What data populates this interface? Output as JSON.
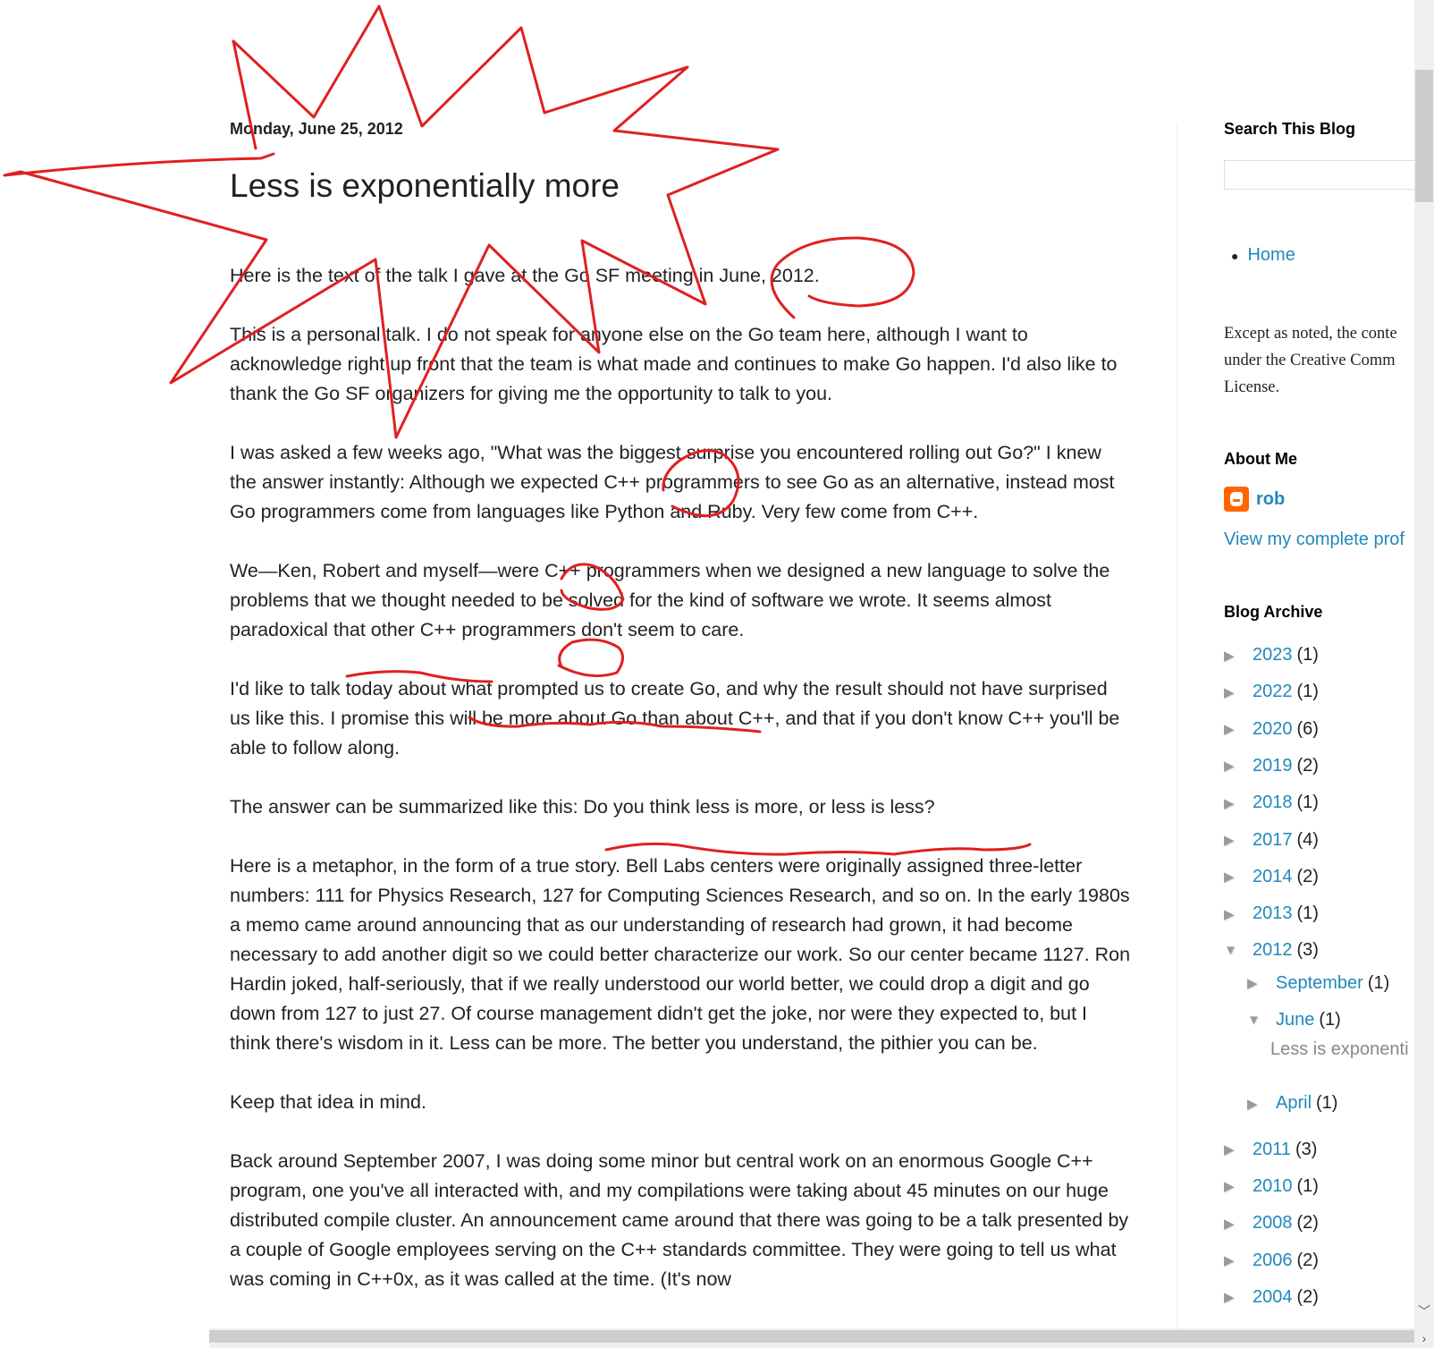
{
  "post": {
    "date": "Monday, June 25, 2012",
    "title": "Less is exponentially more",
    "paragraphs": [
      "Here is the text of the talk I gave at the Go SF meeting in June, 2012.",
      "This is a personal talk. I do not speak for anyone else on the Go team here, although I want to acknowledge right up front that the team is what made and continues to make Go happen. I'd also like to thank the Go SF organizers for giving me the opportunity to talk to you.",
      "I was asked a few weeks ago, \"What was the biggest surprise you encountered rolling out Go?\" I knew the answer instantly: Although we expected C++ programmers to see Go as an alternative, instead most Go programmers come from languages like Python and Ruby. Very few come from C++.",
      "We—Ken, Robert and myself—were C++ programmers when we designed a new language to solve the problems that we thought needed to be solved for the kind of software we wrote. It seems almost paradoxical that other C++ programmers don't seem to care.",
      "I'd like to talk today about what prompted us to create Go, and why the result should not have surprised us like this. I promise this will be more about Go than about C++, and that if you don't know C++ you'll be able to follow along.",
      "The answer can be summarized like this: Do you think less is more, or less is less?",
      "Here is a metaphor, in the form of a true story.  Bell Labs centers were originally assigned three-letter numbers: 111 for Physics Research, 127 for Computing Sciences Research, and so on. In the early 1980s a memo came around announcing that as our understanding of research had grown, it had become necessary to add another digit so we could better characterize our work. So our center became 1127. Ron Hardin joked, half-seriously, that if we really understood our world better, we could drop a digit and go down from 127 to just 27. Of course management didn't get the joke, nor were they expected to, but I think there's wisdom in it. Less can be more. The better you understand, the pithier you can be.",
      "Keep that idea in mind.",
      "Back around September 2007, I was doing some minor but central work on an enormous Google C++ program, one you've all interacted with, and my compilations were taking about 45 minutes on our huge distributed compile cluster. An announcement came around that there was going to be a talk presented by a couple of Google employees serving on the C++ standards committee. They were going to tell us what was coming in C++0x, as it was called at the time. (It's now"
    ]
  },
  "sidebar": {
    "search_title": "Search This Blog",
    "search_value": "",
    "pages": [
      {
        "label": "Home"
      }
    ],
    "license_lines": [
      "Except as noted, the conte",
      "under the Creative Comm",
      "License."
    ],
    "about_title": "About Me",
    "profile_name": "rob",
    "profile_icon": "blogger-icon",
    "view_profile": "View my complete prof",
    "archive_title": "Blog Archive",
    "archive": [
      {
        "label": "2023",
        "count": "(1)",
        "expanded": false
      },
      {
        "label": "2022",
        "count": "(1)",
        "expanded": false
      },
      {
        "label": "2020",
        "count": "(6)",
        "expanded": false
      },
      {
        "label": "2019",
        "count": "(2)",
        "expanded": false
      },
      {
        "label": "2018",
        "count": "(1)",
        "expanded": false
      },
      {
        "label": "2017",
        "count": "(4)",
        "expanded": false
      },
      {
        "label": "2014",
        "count": "(2)",
        "expanded": false
      },
      {
        "label": "2013",
        "count": "(1)",
        "expanded": false
      },
      {
        "label": "2012",
        "count": "(3)",
        "expanded": true
      },
      {
        "label": "2011",
        "count": "(3)",
        "expanded": false
      },
      {
        "label": "2010",
        "count": "(1)",
        "expanded": false
      },
      {
        "label": "2008",
        "count": "(2)",
        "expanded": false
      },
      {
        "label": "2006",
        "count": "(2)",
        "expanded": false
      },
      {
        "label": "2004",
        "count": "(2)",
        "expanded": false
      }
    ],
    "archive_2012_months": [
      {
        "label": "September",
        "count": "(1)",
        "expanded": false
      },
      {
        "label": "June",
        "count": "(1)",
        "expanded": true
      },
      {
        "label": "April",
        "count": "(1)",
        "expanded": false
      }
    ],
    "june_posts": [
      "Less is exponenti"
    ],
    "collapsed_glyph": "▶",
    "expanded_glyph": "▼"
  },
  "scrollbars": {
    "up_glyph": "︿",
    "down_glyph": "﹀",
    "right_glyph": "›"
  },
  "annotations": {
    "color": "#e02020",
    "marks": [
      "starburst around title",
      "circle around June, 2012",
      "circles around C++",
      "underline paradoxical",
      "underline what prompted us to create Go",
      "underline Do you think less is more, or less is less?"
    ]
  }
}
